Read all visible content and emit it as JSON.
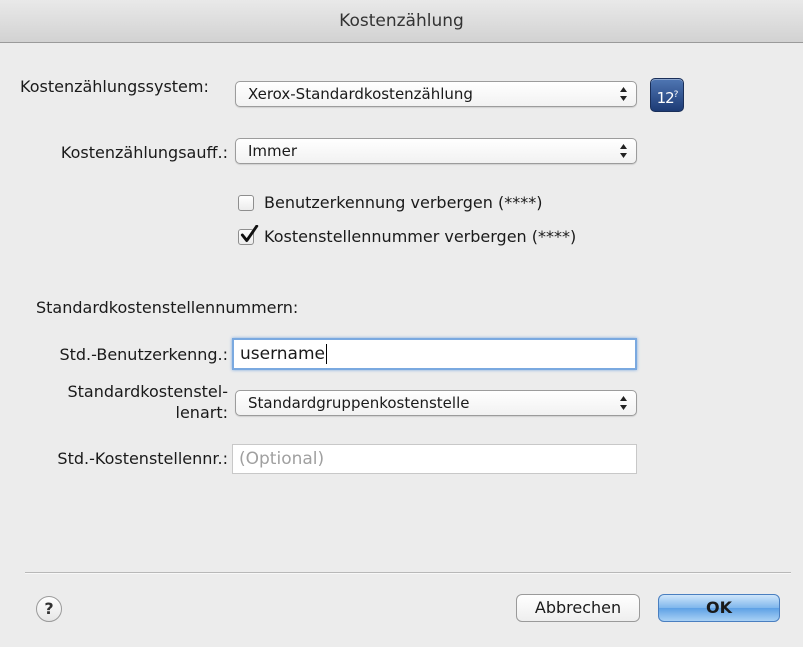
{
  "window": {
    "title": "Kostenzählung"
  },
  "accounting": {
    "system_label": "Kostenzählungssystem:",
    "system_value": "Xerox-Standardkostenzählung",
    "prompt_label": "Kostenzählungsauff.:",
    "prompt_value": "Immer",
    "calculator_icon_text": "12"
  },
  "options": {
    "hide_user_id": {
      "label": "Benutzerkennung verbergen (****)",
      "checked": false
    },
    "hide_account_id": {
      "label": "Kostenstellennummer verbergen (****)",
      "checked": true
    }
  },
  "defaults": {
    "section_title": "Standardkostenstellennummern:",
    "user_id_label": "Std.-Benutzerkenng.:",
    "user_id_value": "username",
    "account_type_label_line1": "Standardkostenstel-",
    "account_type_label_line2": "lenart:",
    "account_type_value": "Standardgruppenkostenstelle",
    "account_id_label": "Std.-Kostenstellennr.:",
    "account_id_placeholder": "(Optional)"
  },
  "footer": {
    "help_icon": "?",
    "cancel_label": "Abbrechen",
    "ok_label": "OK"
  }
}
